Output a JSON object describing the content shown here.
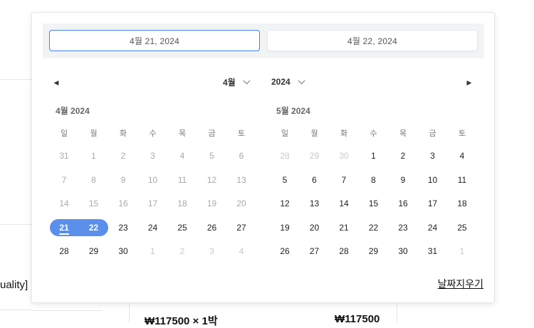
{
  "background": {
    "left_text": "uality]",
    "bottom_price_left": "₩117500 × 1박",
    "bottom_price_right": "₩117500"
  },
  "range": {
    "start_value": "4월 21, 2024",
    "end_value": "4월 22, 2024"
  },
  "nav": {
    "prev_icon": "◀",
    "next_icon": "▶",
    "month_select": "4월",
    "year_select": "2024"
  },
  "weekday_labels": [
    "일",
    "월",
    "화",
    "수",
    "목",
    "금",
    "토"
  ],
  "months": [
    {
      "title": "4월 2024",
      "weeks": [
        [
          "31",
          "1",
          "2",
          "3",
          "4",
          "5",
          "6"
        ],
        [
          "7",
          "8",
          "9",
          "10",
          "11",
          "12",
          "13"
        ],
        [
          "14",
          "15",
          "16",
          "17",
          "18",
          "19",
          "20"
        ],
        [
          "21",
          "22",
          "23",
          "24",
          "25",
          "26",
          "27"
        ],
        [
          "28",
          "29",
          "30",
          "1",
          "2",
          "3",
          "4"
        ]
      ]
    },
    {
      "title": "5월 2024",
      "weeks": [
        [
          "28",
          "29",
          "30",
          "1",
          "2",
          "3",
          "4"
        ],
        [
          "5",
          "6",
          "7",
          "8",
          "9",
          "10",
          "11"
        ],
        [
          "12",
          "13",
          "14",
          "15",
          "16",
          "17",
          "18"
        ],
        [
          "19",
          "20",
          "21",
          "22",
          "23",
          "24",
          "25"
        ],
        [
          "26",
          "27",
          "28",
          "29",
          "30",
          "31",
          "1"
        ]
      ]
    }
  ],
  "clear_label": "날짜지우기",
  "colors": {
    "accent": "#5b8fec",
    "start_border": "#3b82f6"
  }
}
